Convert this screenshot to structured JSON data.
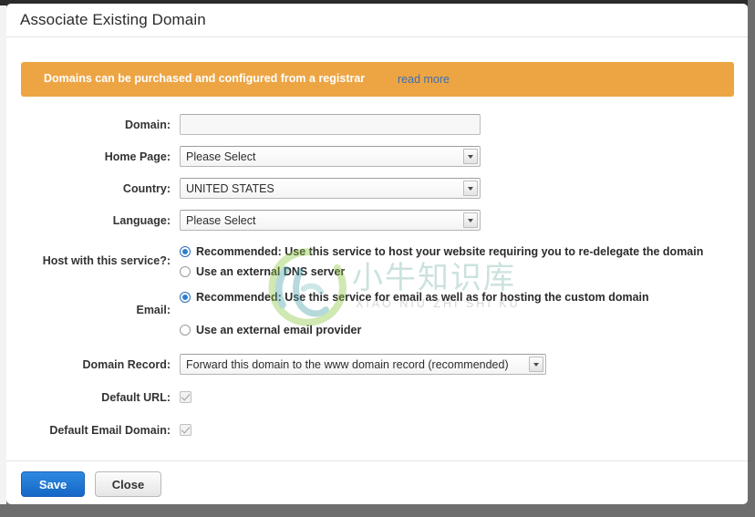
{
  "dialog": {
    "title": "Associate Existing Domain"
  },
  "banner": {
    "message": "Domains can be purchased and configured from a registrar",
    "link_label": "read more",
    "background_color": "#eda544",
    "link_color": "#3c6fb0"
  },
  "form": {
    "domain": {
      "label": "Domain:",
      "value": "",
      "placeholder": ""
    },
    "home_page": {
      "label": "Home Page:",
      "selected": "Please Select"
    },
    "country": {
      "label": "Country:",
      "selected": "UNITED STATES"
    },
    "language": {
      "label": "Language:",
      "selected": "Please Select"
    },
    "host_with_service": {
      "label": "Host with this service?:",
      "options": [
        "Recommended: Use this service to host your website requiring you to re-delegate the domain",
        "Use an external DNS server"
      ],
      "selected_index": 0
    },
    "email": {
      "label": "Email:",
      "options": [
        "Recommended: Use this service for email as well as for hosting the custom domain",
        "Use an external email provider"
      ],
      "selected_index": 0
    },
    "domain_record": {
      "label": "Domain Record:",
      "selected": "Forward this domain to the www domain record (recommended)"
    },
    "default_url": {
      "label": "Default URL:",
      "checked": true
    },
    "default_email_domain": {
      "label": "Default Email Domain:",
      "checked": true
    }
  },
  "footer": {
    "save_label": "Save",
    "close_label": "Close",
    "save_color": "#1b6fd0"
  },
  "watermark": {
    "chinese_text": "小牛知识库",
    "pinyin_text": "XIAO NIU ZHI SHI KU",
    "logo_color": "#4aa3a8"
  }
}
